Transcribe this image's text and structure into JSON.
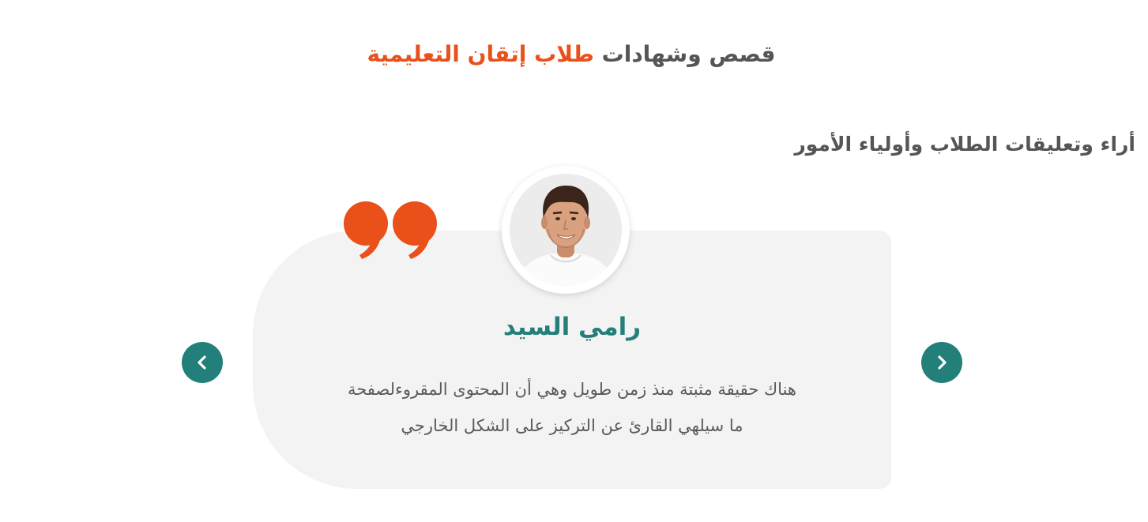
{
  "header": {
    "title_part1": "قصص وشهادات",
    "title_part2": "طلاب إتقان التعليمية",
    "accent_color": "#e9501a",
    "text_color": "#555555"
  },
  "subtitle": "أراء وتعليقات الطلاب وأولياء الأمور",
  "testimonial": {
    "name": "رامي السيد",
    "text_line1": "هناك حقيقة مثبتة منذ زمن طويل وهي أن المحتوى المقروءلصفحة",
    "text_line2": "ما سيلهي القارئ عن التركيز على الشكل الخارجي",
    "name_color": "#237f7a",
    "card_color": "#f3f3f3",
    "quote_icon": "quote-icon",
    "avatar": "avatar-photo"
  },
  "carousel": {
    "prev_icon": "chevron-left-icon",
    "next_icon": "chevron-right-icon",
    "button_color": "#237f7a"
  }
}
